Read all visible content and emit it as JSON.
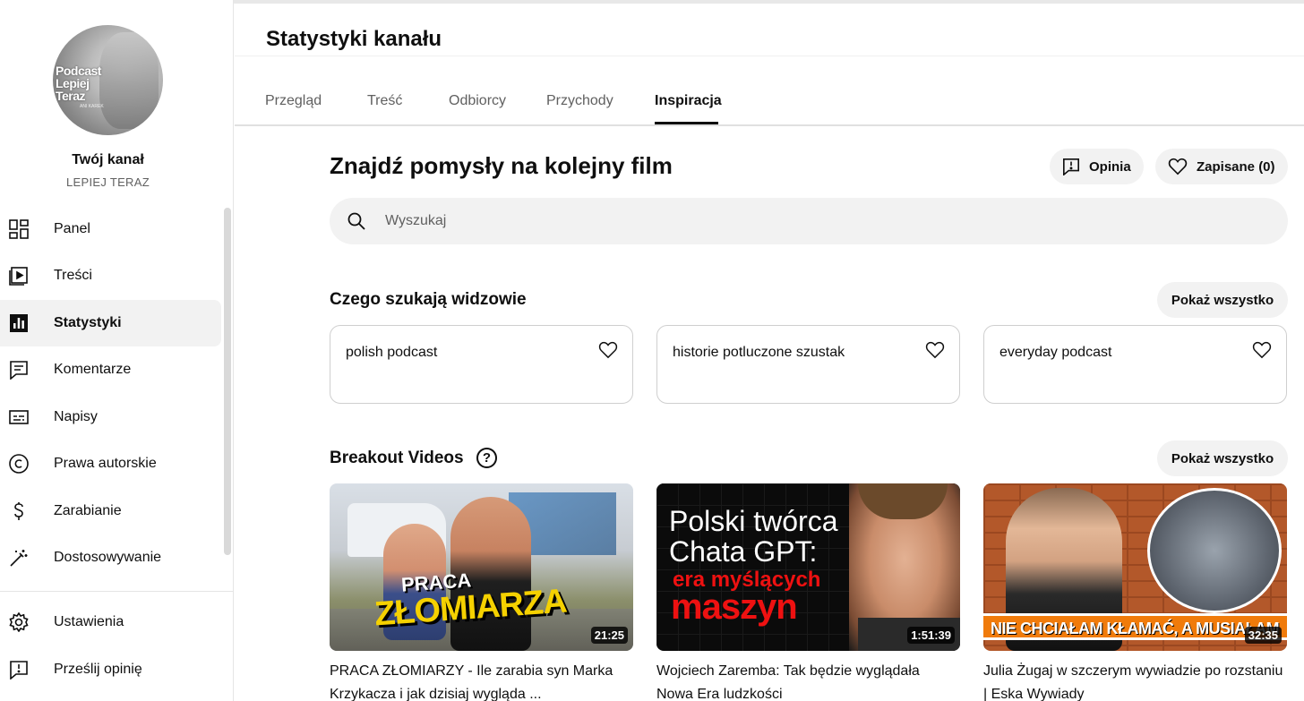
{
  "sidebar": {
    "avatar_text": [
      "Podcast",
      "Lepiej",
      "Teraz"
    ],
    "avatar_small": "ANI KAREK",
    "channel_title": "Twój kanał",
    "channel_name": "LEPIEJ TERAZ",
    "items": [
      {
        "label": "Panel",
        "icon": "dashboard-icon"
      },
      {
        "label": "Treści",
        "icon": "content-icon"
      },
      {
        "label": "Statystyki",
        "icon": "analytics-icon",
        "active": true
      },
      {
        "label": "Komentarze",
        "icon": "comments-icon"
      },
      {
        "label": "Napisy",
        "icon": "subtitles-icon"
      },
      {
        "label": "Prawa autorskie",
        "icon": "copyright-icon"
      },
      {
        "label": "Zarabianie",
        "icon": "monetization-icon"
      },
      {
        "label": "Dostosowywanie",
        "icon": "customization-icon"
      }
    ],
    "bottom_items": [
      {
        "label": "Ustawienia",
        "icon": "gear-icon"
      },
      {
        "label": "Prześlij opinię",
        "icon": "feedback-icon"
      }
    ]
  },
  "header": {
    "page_title": "Statystyki kanału",
    "tabs": [
      {
        "label": "Przegląd"
      },
      {
        "label": "Treść"
      },
      {
        "label": "Odbiorcy"
      },
      {
        "label": "Przychody"
      },
      {
        "label": "Inspiracja",
        "active": true
      }
    ]
  },
  "main": {
    "heading": "Znajdź pomysły na kolejny film",
    "feedback_button": "Opinia",
    "saved_button": "Zapisane (0)",
    "search_placeholder": "Wyszukaj",
    "viewers_section": {
      "title": "Czego szukają widzowie",
      "show_all": "Pokaż wszystko",
      "cards": [
        "polish podcast",
        "historie potluczone szustak",
        "everyday podcast"
      ]
    },
    "breakout_section": {
      "title": "Breakout Videos",
      "help": "?",
      "show_all": "Pokaż wszystko",
      "videos": [
        {
          "duration": "21:25",
          "title": "PRACA ZŁOMIARZY - Ile zarabia syn Marka Krzykacza i jak dzisiaj wygląda ...",
          "thumb_text": [
            "PRACA",
            "ZŁOMIARZA"
          ]
        },
        {
          "duration": "1:51:39",
          "title": "Wojciech Zaremba: Tak będzie wyglądała Nowa Era ludzkości",
          "thumb_text": [
            "Polski twórca",
            "Chata GPT:",
            "era myślących",
            "maszyn"
          ]
        },
        {
          "duration": "32:35",
          "title": "Julia Żugaj w szczerym wywiadzie po rozstaniu | Eska Wywiady",
          "thumb_text": [
            "NIE CHCIAŁAM KŁAMAĆ, A MUSIAŁAM"
          ]
        }
      ]
    }
  }
}
